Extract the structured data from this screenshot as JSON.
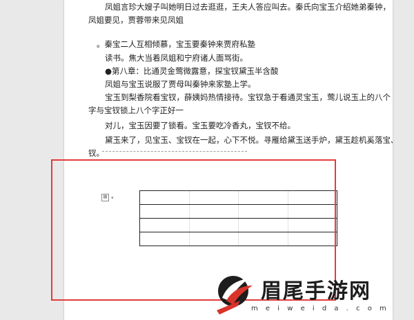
{
  "document": {
    "paragraphs": [
      {
        "lines": [
          {
            "text": "凤姐言珍大嫂子叫她明日过去逛逛，王夫人答应叫去。秦氏向宝玉介绍她弟秦钟，",
            "indent": 2
          },
          {
            "text": "凤姐要见，贾蓉带来见凤姐",
            "indent": 0
          }
        ]
      },
      {
        "lines": [
          {
            "text": "。秦宝二人互相倾慕，宝玉要秦钟来贾府私塾",
            "indent": 1
          }
        ]
      },
      {
        "lines": [
          {
            "text": "读书。焦大当着凤姐和宁府诸人面骂街。",
            "indent": 2
          }
        ]
      },
      {
        "lines": [
          {
            "text": "●第八章：比通灵金莺微露意，探宝钗黛玉半含酸",
            "indent": 2
          }
        ]
      },
      {
        "lines": [
          {
            "text": "凤姐与宝玉说服了贾母叫秦钟来家塾上学。",
            "indent": 2
          }
        ]
      },
      {
        "lines": [
          {
            "text": "宝玉到梨香院看宝钗，薛姨妈热情接待。宝钗急于看通灵宝玉，莺儿说玉上的八个",
            "indent": 2
          },
          {
            "text": "字与宝钗锁上八个字正好一",
            "indent": 0
          }
        ]
      },
      {
        "lines": [
          {
            "text": "对儿，宝玉因要了锁看。宝玉要吃冷香丸，宝钗不给。",
            "indent": 2
          }
        ]
      },
      {
        "lines": [
          {
            "text": "黛玉来了，见宝玉、宝钗在一起，心下不悦。寻雁给黛玉送手炉，黛玉趁机奚落宝、",
            "indent": 2
          },
          {
            "text": "钗。",
            "indent": 0
          }
        ]
      }
    ],
    "table": {
      "rows": 4,
      "cols": 4
    },
    "table_handle_glyph": "⊞"
  },
  "watermark": {
    "text": "眉尾手游网",
    "url": "m e i w e i d a . c o m"
  },
  "colors": {
    "highlight_border": "#e23b3b",
    "logo_red": "#d8342b",
    "logo_dark": "#1d1d1d"
  }
}
